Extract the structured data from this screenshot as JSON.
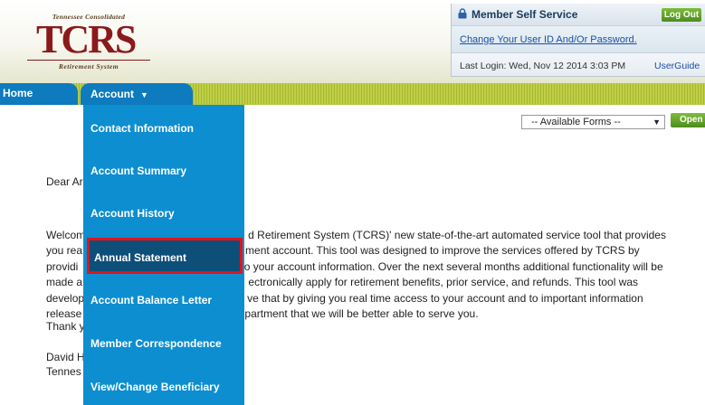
{
  "logo": {
    "top_text": "Tennessee Consolidated",
    "mark_text": "TCRS",
    "bottom_text": "Retirement System"
  },
  "mss": {
    "title": "Member Self Service",
    "logout_label": "Log Out",
    "change_link": "Change Your User ID And/Or Password.",
    "last_login": "Last Login: Wed, Nov 12 2014 3:03 PM",
    "user_guide": "UserGuide"
  },
  "nav": {
    "home_label": "Home",
    "account_label": "Account",
    "account_caret": "▼"
  },
  "menu": {
    "items": [
      {
        "label": "Contact Information"
      },
      {
        "label": "Account Summary"
      },
      {
        "label": "Account History"
      },
      {
        "label": "Annual Statement"
      },
      {
        "label": "Account Balance Letter"
      },
      {
        "label": "Member Correspondence"
      },
      {
        "label": "View/Change Beneficiary"
      }
    ],
    "highlighted": "Annual Statement"
  },
  "forms": {
    "selected": "-- Available Forms --",
    "open_label": "Open"
  },
  "content": {
    "greeting": "Dear Ar",
    "lines": [
      "Welcom                                                      d Retirement System (TCRS)' new state-of-the-art automated service tool that provides",
      "you rea                                                      ment account. This tool was designed to improve the services offered by TCRS by",
      "providi                                                      to your account information. Over the next several months additional functionality will be",
      "made a                                                       ectronically apply for retirement benefits, prior service, and refunds. This tool was",
      "develop                                                      ve that by giving you real time access to your account and to important information",
      "release                                                      partment that we will be better able to serve you."
    ],
    "thanks": "Thank y",
    "sig_name": "David H",
    "sig_title": "Tennes"
  },
  "colors": {
    "nav_blue": "#0d7bbd",
    "menu_blue": "#0d8ed0",
    "highlight_bg": "#0e4f7a",
    "highlight_border": "#e0141b",
    "nav_green": "#bfcf48",
    "logo_red": "#8b1a1a"
  }
}
